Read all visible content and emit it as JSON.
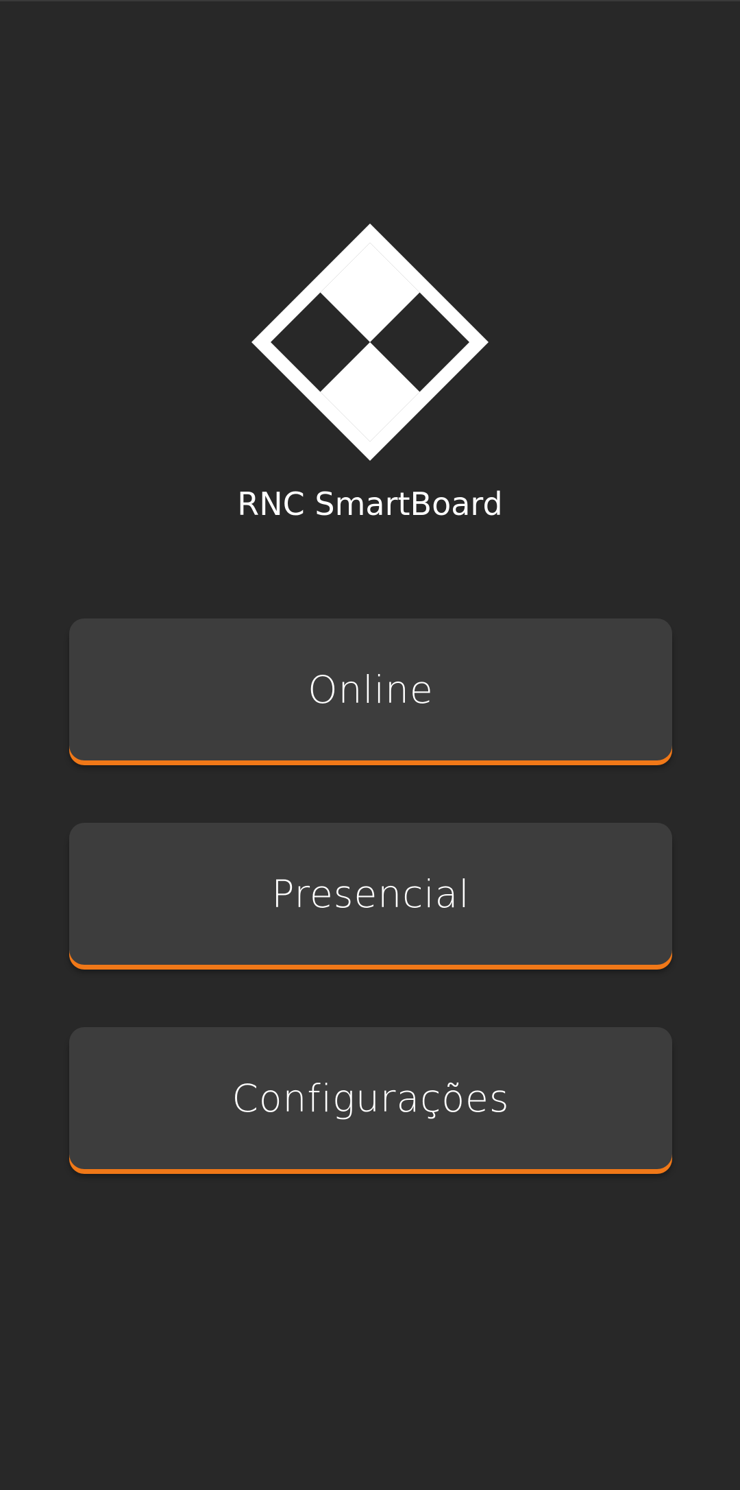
{
  "app": {
    "title": "RNC SmartBoard",
    "logo_icon": "diamond-checker-logo-icon"
  },
  "menu": {
    "online_label": "Online",
    "presencial_label": "Presencial",
    "settings_label": "Configurações"
  },
  "colors": {
    "background": "#282828",
    "button_background": "#3d3d3d",
    "accent": "#f07818",
    "text": "#ffffff"
  }
}
